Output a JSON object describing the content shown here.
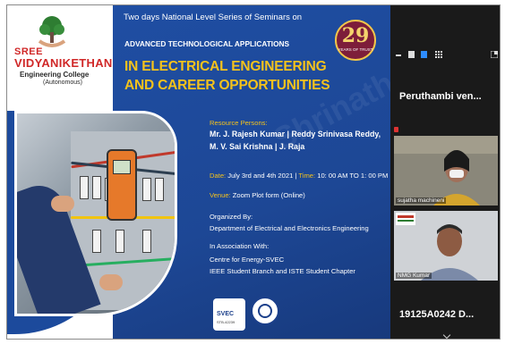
{
  "slide": {
    "college_line1": "SREE",
    "college_line2": "VIDYANIKETHAN",
    "college_line3": "Engineering College",
    "college_line4": "(Autonomous)",
    "top_line": "Two days National Level Series of Seminars on",
    "subtitle": "ADVANCED TECHNOLOGICAL APPLICATIONS",
    "main_line1": "IN ELECTRICAL ENGINEERING",
    "main_line2": "AND CAREER OPPORTUNITIES",
    "badge_number": "29",
    "badge_text": "YEARS OF TRUST",
    "resource_label": "Resource Persons:",
    "resource_line1": "Mr. J. Rajesh Kumar | Reddy Srinivasa Reddy,",
    "resource_line2": "M. V. Sai Krishna | J. Raja",
    "date_label": "Date:",
    "date_value": "July 3rd and 4th 2021",
    "time_label": "Time:",
    "time_value": "10: 00 AM TO 1: 00 PM",
    "venue_label": "Venue:",
    "venue_value": "Zoom Plot form (Online)",
    "organized_label": "Organized By:",
    "organized_value": "Department of Electrical and Electronics Engineering",
    "association_label": "In Association With:",
    "association_line1": "Centre for Energy-SVEC",
    "association_line2": "IEEE Student Branch and ISTE Student Chapter",
    "svec_logo_text": "SVEC",
    "svec_logo_sub": "STB-42239",
    "watermark": "Shrinath.p"
  },
  "participants": {
    "top_name": "Peruthambi ven...",
    "tile1_label": "sujatha machineni",
    "tile2_label": "NMG Kumar",
    "bottom_name": "19125A0242 D..."
  },
  "colors": {
    "slide_blue": "#1f4ea3",
    "headline_yellow": "#f4c21c",
    "college_red": "#d02828",
    "panel_bg": "#1a1a1a"
  }
}
